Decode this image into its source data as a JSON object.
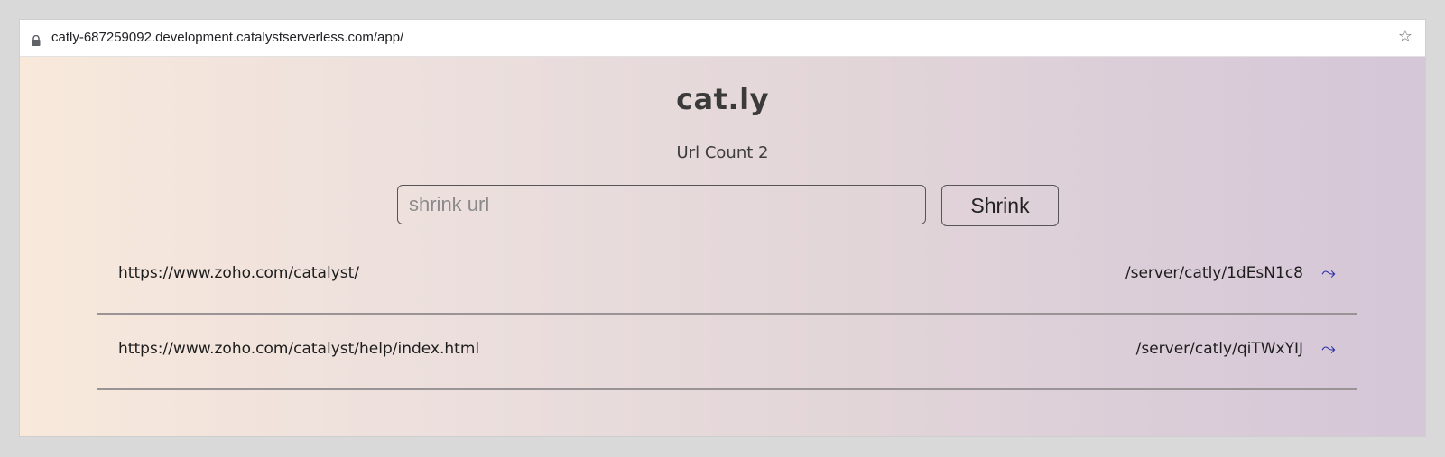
{
  "browser": {
    "url": "catly-687259092.development.catalystserverless.com/app/",
    "lock_icon": "lock-icon",
    "star_icon": "star-icon"
  },
  "app": {
    "title": "cat.ly",
    "url_count": "Url Count 2",
    "input": {
      "placeholder": "shrink url",
      "value": ""
    },
    "shrink_label": "Shrink",
    "rows": [
      {
        "long_url": "https://www.zoho.com/catalyst/",
        "short_url": "/server/catly/1dEsN1c8",
        "icon": "arrow-right-icon"
      },
      {
        "long_url": "https://www.zoho.com/catalyst/help/index.html",
        "short_url": "/server/catly/qiTWxYIJ",
        "icon": "arrow-right-icon"
      }
    ],
    "colors": {
      "gradient_left": "#f8e9db",
      "gradient_right": "#d5c6d8",
      "link_arrow": "#2b2ea8"
    }
  }
}
